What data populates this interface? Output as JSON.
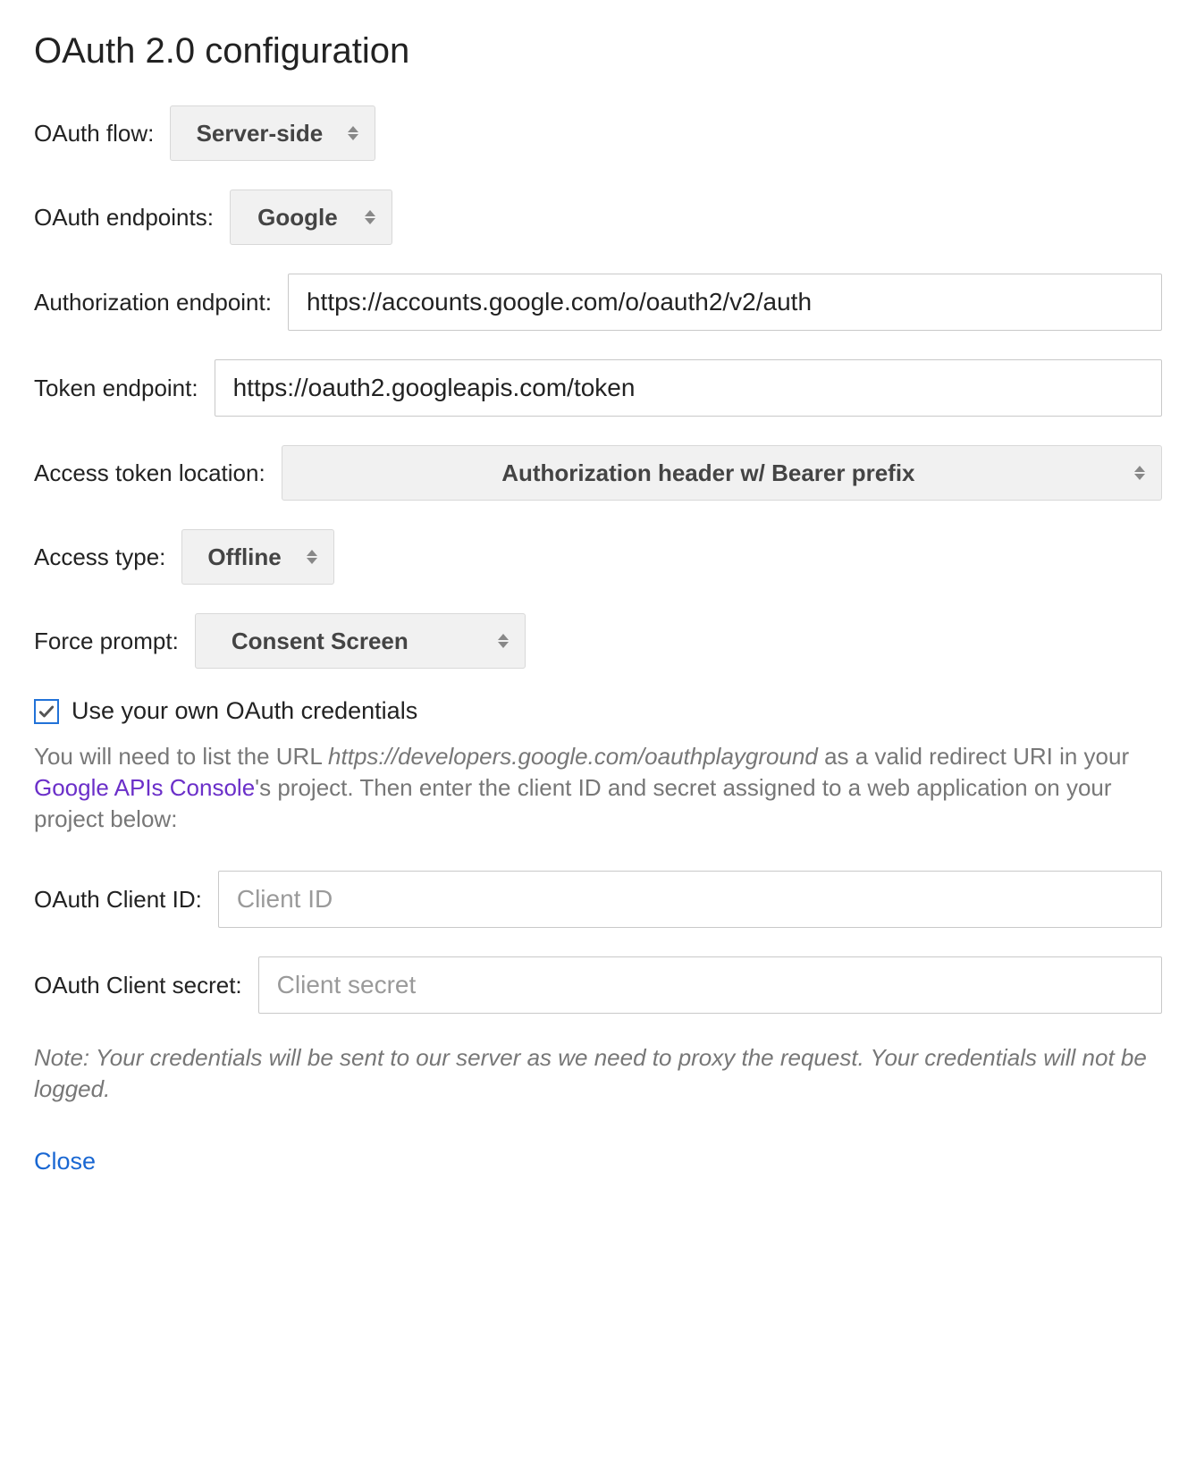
{
  "title": "OAuth 2.0 configuration",
  "fields": {
    "oauth_flow": {
      "label": "OAuth flow:",
      "value": "Server-side"
    },
    "oauth_endpoints": {
      "label": "OAuth endpoints:",
      "value": "Google"
    },
    "auth_endpoint": {
      "label": "Authorization endpoint:",
      "value": "https://accounts.google.com/o/oauth2/v2/auth"
    },
    "token_endpoint": {
      "label": "Token endpoint:",
      "value": "https://oauth2.googleapis.com/token"
    },
    "token_location": {
      "label": "Access token location:",
      "value": "Authorization header w/ Bearer prefix"
    },
    "access_type": {
      "label": "Access type:",
      "value": "Offline"
    },
    "force_prompt": {
      "label": "Force prompt:",
      "value": "Consent Screen"
    },
    "use_own_credentials": {
      "checked": true,
      "label": "Use your own OAuth credentials"
    },
    "client_id": {
      "label": "OAuth Client ID:",
      "placeholder": "Client ID",
      "value": ""
    },
    "client_secret": {
      "label": "OAuth Client secret:",
      "placeholder": "Client secret",
      "value": ""
    }
  },
  "help": {
    "prefix": "You will need to list the URL ",
    "url": "https://developers.google.com/oauthplayground",
    "mid1": " as a valid redirect URI in your ",
    "link": "Google APIs Console",
    "suffix": "'s project. Then enter the client ID and secret assigned to a web application on your project below:"
  },
  "note": "Note: Your credentials will be sent to our server as we need to proxy the request. Your credentials will not be logged.",
  "close": "Close"
}
